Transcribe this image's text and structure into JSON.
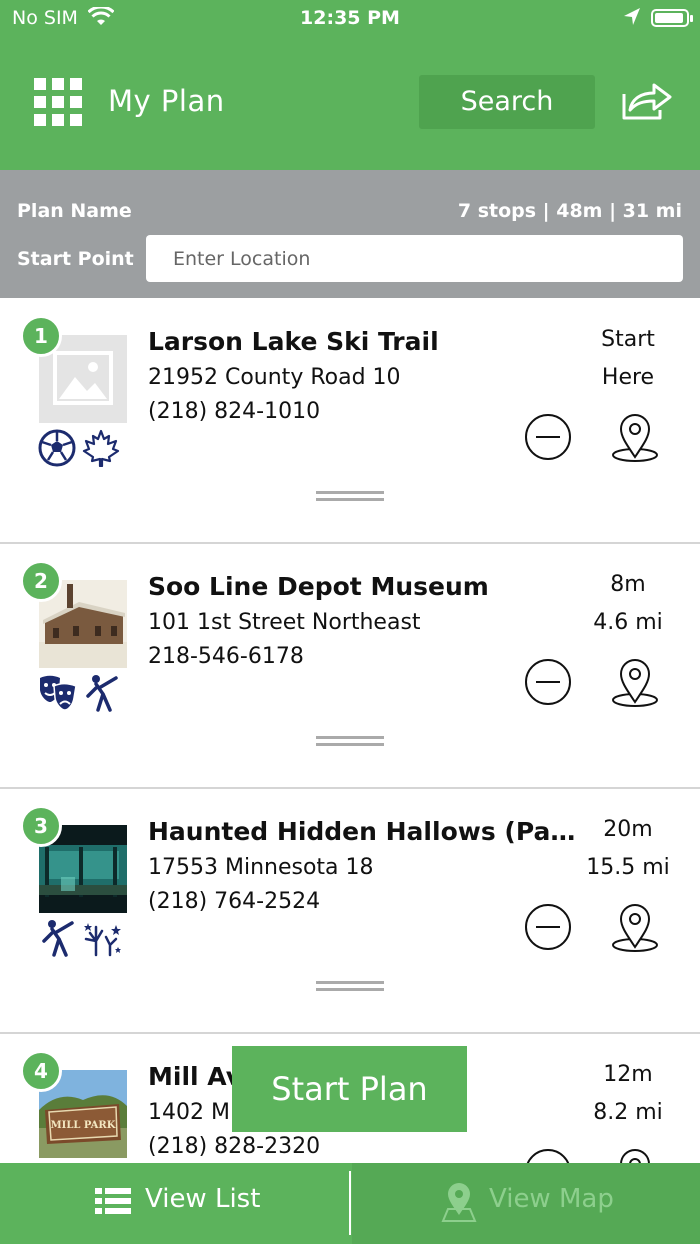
{
  "status_bar": {
    "carrier": "No SIM",
    "time": "12:35 PM"
  },
  "header": {
    "title": "My Plan",
    "search_label": "Search"
  },
  "plan": {
    "name_label": "Plan Name",
    "summary": "7 stops | 48m | 31 mi",
    "start_label": "Start Point",
    "start_placeholder": "Enter Location"
  },
  "stops": [
    {
      "number": "1",
      "name": "Larson Lake Ski Trail",
      "address": "21952 County Road 10",
      "phone": "(218) 824-1010",
      "meta1": "Start",
      "meta2": "Here",
      "icons": [
        "soccer-ball-icon",
        "maple-leaf-icon"
      ]
    },
    {
      "number": "2",
      "name": "Soo Line Depot Museum",
      "address": "101 1st Street Northeast",
      "phone": "218-546-6178",
      "meta1": "8m",
      "meta2": "4.6 mi",
      "icons": [
        "theater-masks-icon",
        "dancer-icon"
      ]
    },
    {
      "number": "3",
      "name": "Haunted Hidden Hallows (Pau...",
      "address": "17553 Minnesota 18",
      "phone": "(218) 764-2524",
      "meta1": "20m",
      "meta2": "15.5 mi",
      "icons": [
        "dancer-icon",
        "fireworks-icon"
      ]
    },
    {
      "number": "4",
      "name": "Mill Av",
      "address": "1402 Mi",
      "phone": "(218) 828-2320",
      "meta1": "12m",
      "meta2": "8.2 mi",
      "thumb_text": "MILL PARK"
    }
  ],
  "start_plan_label": "Start Plan",
  "bottom_tabs": {
    "list_label": "View List",
    "map_label": "View Map"
  },
  "colors": {
    "brand_green": "#5cb35c",
    "plan_bar_gray": "#9c9fa1",
    "icon_navy": "#1c2b6e"
  }
}
